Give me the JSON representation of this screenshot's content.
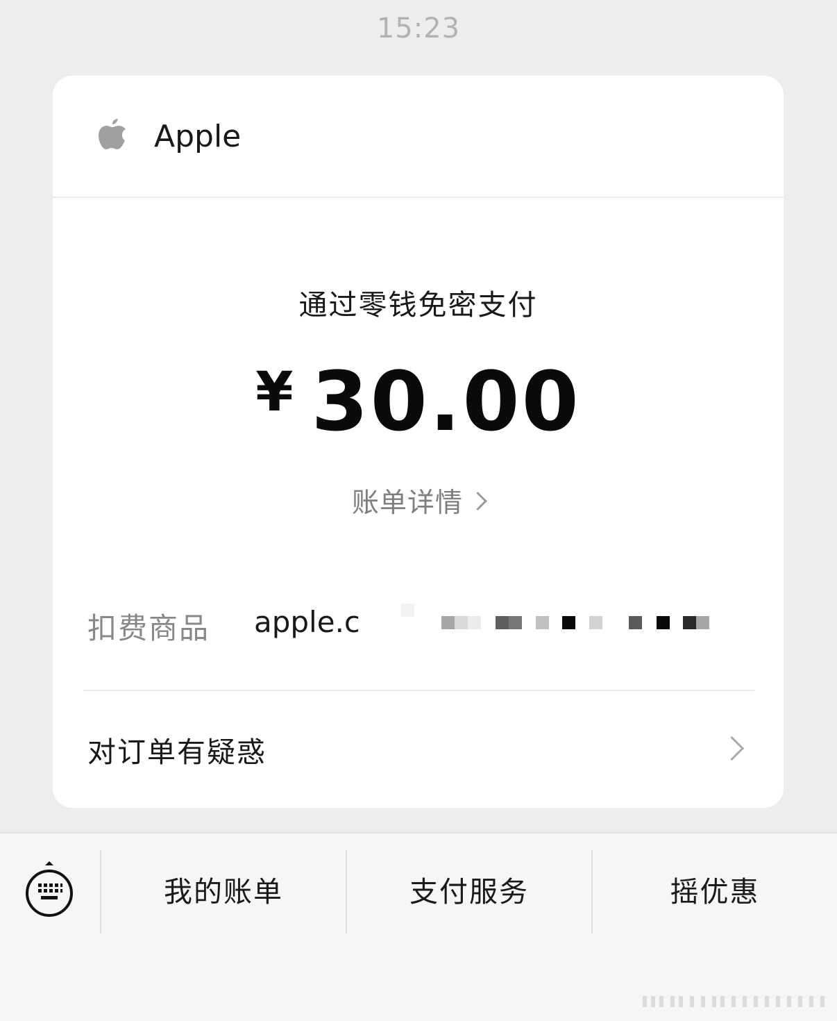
{
  "timestamp": "15:23",
  "card": {
    "merchant": "Apple",
    "logo_icon": "apple-logo-icon",
    "pay_method": "通过零钱免密支付",
    "currency": "¥",
    "amount": "30.00",
    "bill_detail": "账单详情",
    "product_label": "扣费商品",
    "product_value": "apple.c",
    "query_label": "对订单有疑惑"
  },
  "bottom_menu": {
    "keyboard_icon": "keyboard-icon",
    "items": [
      {
        "label": "我的账单"
      },
      {
        "label": "支付服务"
      },
      {
        "label": "摇优惠"
      }
    ]
  },
  "colors": {
    "background": "#ededed",
    "card": "#ffffff",
    "text_primary": "#191919",
    "text_secondary": "#888888",
    "bottom_bar": "#f6f6f6"
  }
}
